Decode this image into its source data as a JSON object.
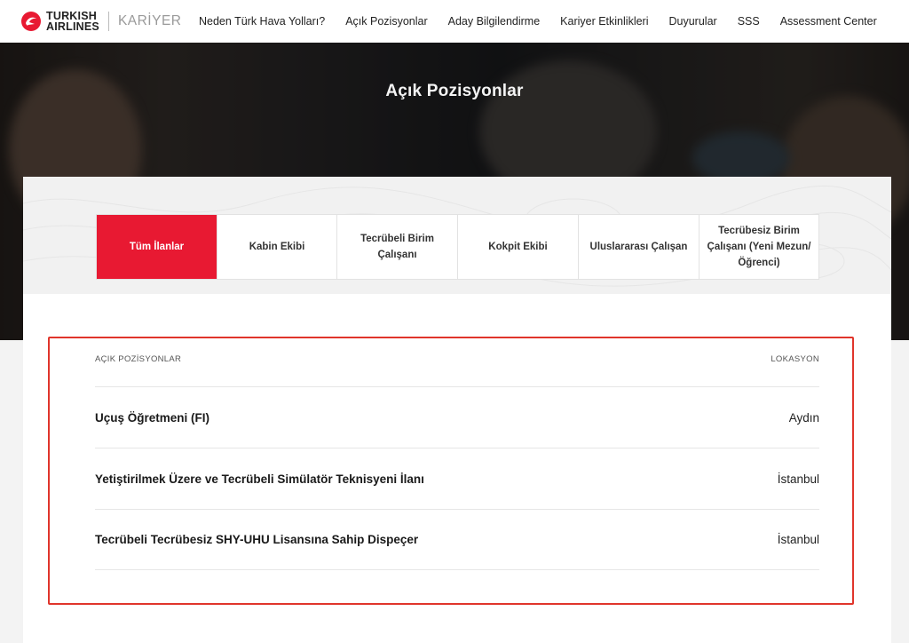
{
  "brand": {
    "line1": "TURKISH",
    "line2": "AIRLINES",
    "section": "KARİYER",
    "accent": "#e81932"
  },
  "nav": {
    "items": [
      "Neden Türk Hava Yolları?",
      "Açık Pozisyonlar",
      "Aday Bilgilendirme",
      "Kariyer Etkinlikleri",
      "Duyurular",
      "SSS",
      "Assessment Center"
    ]
  },
  "hero": {
    "title": "Açık Pozisyonlar"
  },
  "tabs": [
    {
      "label": "Tüm İlanlar",
      "active": true
    },
    {
      "label": "Kabin Ekibi",
      "active": false
    },
    {
      "label": "Tecrübeli Birim Çalışanı",
      "active": false
    },
    {
      "label": "Kokpit Ekibi",
      "active": false
    },
    {
      "label": "Uluslararası Çalışan",
      "active": false
    },
    {
      "label": "Tecrübesiz Birim Çalışanı (Yeni Mezun/ Öğrenci)",
      "active": false
    }
  ],
  "listing": {
    "col_positions": "AÇIK POZİSYONLAR",
    "col_location": "LOKASYON",
    "rows": [
      {
        "title": "Uçuş Öğretmeni (FI)",
        "location": "Aydın"
      },
      {
        "title": "Yetiştirilmek Üzere ve Tecrübeli Simülatör Teknisyeni İlanı",
        "location": "İstanbul"
      },
      {
        "title": "Tecrübeli Tecrübesiz SHY-UHU Lisansına Sahip Dispeçer",
        "location": "İstanbul"
      }
    ]
  },
  "colors": {
    "active_tab": "#e81932",
    "highlight_border": "#e0352b"
  }
}
